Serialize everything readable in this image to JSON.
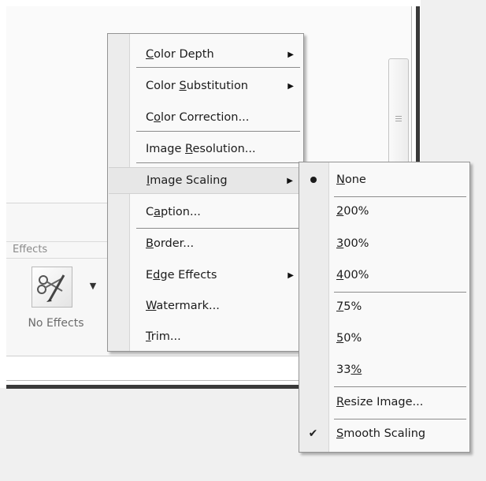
{
  "background": {
    "effects_group": {
      "label": "Effects",
      "button_caption": "No Effects",
      "dropdown_icon": "triangle-down-icon",
      "thumbnail_icon": "scissors-brush-icon"
    }
  },
  "main_menu": {
    "items": [
      {
        "label_pre": "",
        "accel": "C",
        "label_post": "olor Depth",
        "has_submenu": true
      },
      {
        "label_pre": "Color ",
        "accel": "S",
        "label_post": "ubstitution",
        "has_submenu": true
      },
      {
        "label_pre": "C",
        "accel": "o",
        "label_post": "lor Correction...",
        "has_submenu": false
      },
      {
        "label_pre": "Image ",
        "accel": "R",
        "label_post": "esolution...",
        "has_submenu": false
      },
      {
        "label_pre": "",
        "accel": "I",
        "label_post": "mage Scaling",
        "has_submenu": true,
        "highlighted": true
      },
      {
        "label_pre": "C",
        "accel": "a",
        "label_post": "ption...",
        "has_submenu": false
      },
      {
        "label_pre": "",
        "accel": "B",
        "label_post": "order...",
        "has_submenu": false
      },
      {
        "label_pre": "E",
        "accel": "d",
        "label_post": "ge Effects",
        "has_submenu": true
      },
      {
        "label_pre": "",
        "accel": "W",
        "label_post": "atermark...",
        "has_submenu": false
      },
      {
        "label_pre": "",
        "accel": "T",
        "label_post": "rim...",
        "has_submenu": false
      }
    ],
    "submenu_arrow": "▶"
  },
  "scaling_submenu": {
    "items": [
      {
        "label_pre": "",
        "accel": "N",
        "label_post": "one",
        "state": "bullet"
      },
      {
        "label_pre": "",
        "accel": "2",
        "label_post": "00%"
      },
      {
        "label_pre": "",
        "accel": "3",
        "label_post": "00%"
      },
      {
        "label_pre": "",
        "accel": "4",
        "label_post": "00%"
      },
      {
        "label_pre": "",
        "accel": "7",
        "label_post": "5%"
      },
      {
        "label_pre": "",
        "accel": "5",
        "label_post": "0%"
      },
      {
        "label_pre": "33",
        "accel": "%",
        "label_post": ""
      },
      {
        "label_pre": "",
        "accel": "R",
        "label_post": "esize Image..."
      },
      {
        "label_pre": "",
        "accel": "S",
        "label_post": "mooth Scaling",
        "state": "checked"
      }
    ],
    "check_glyph": "✔"
  }
}
